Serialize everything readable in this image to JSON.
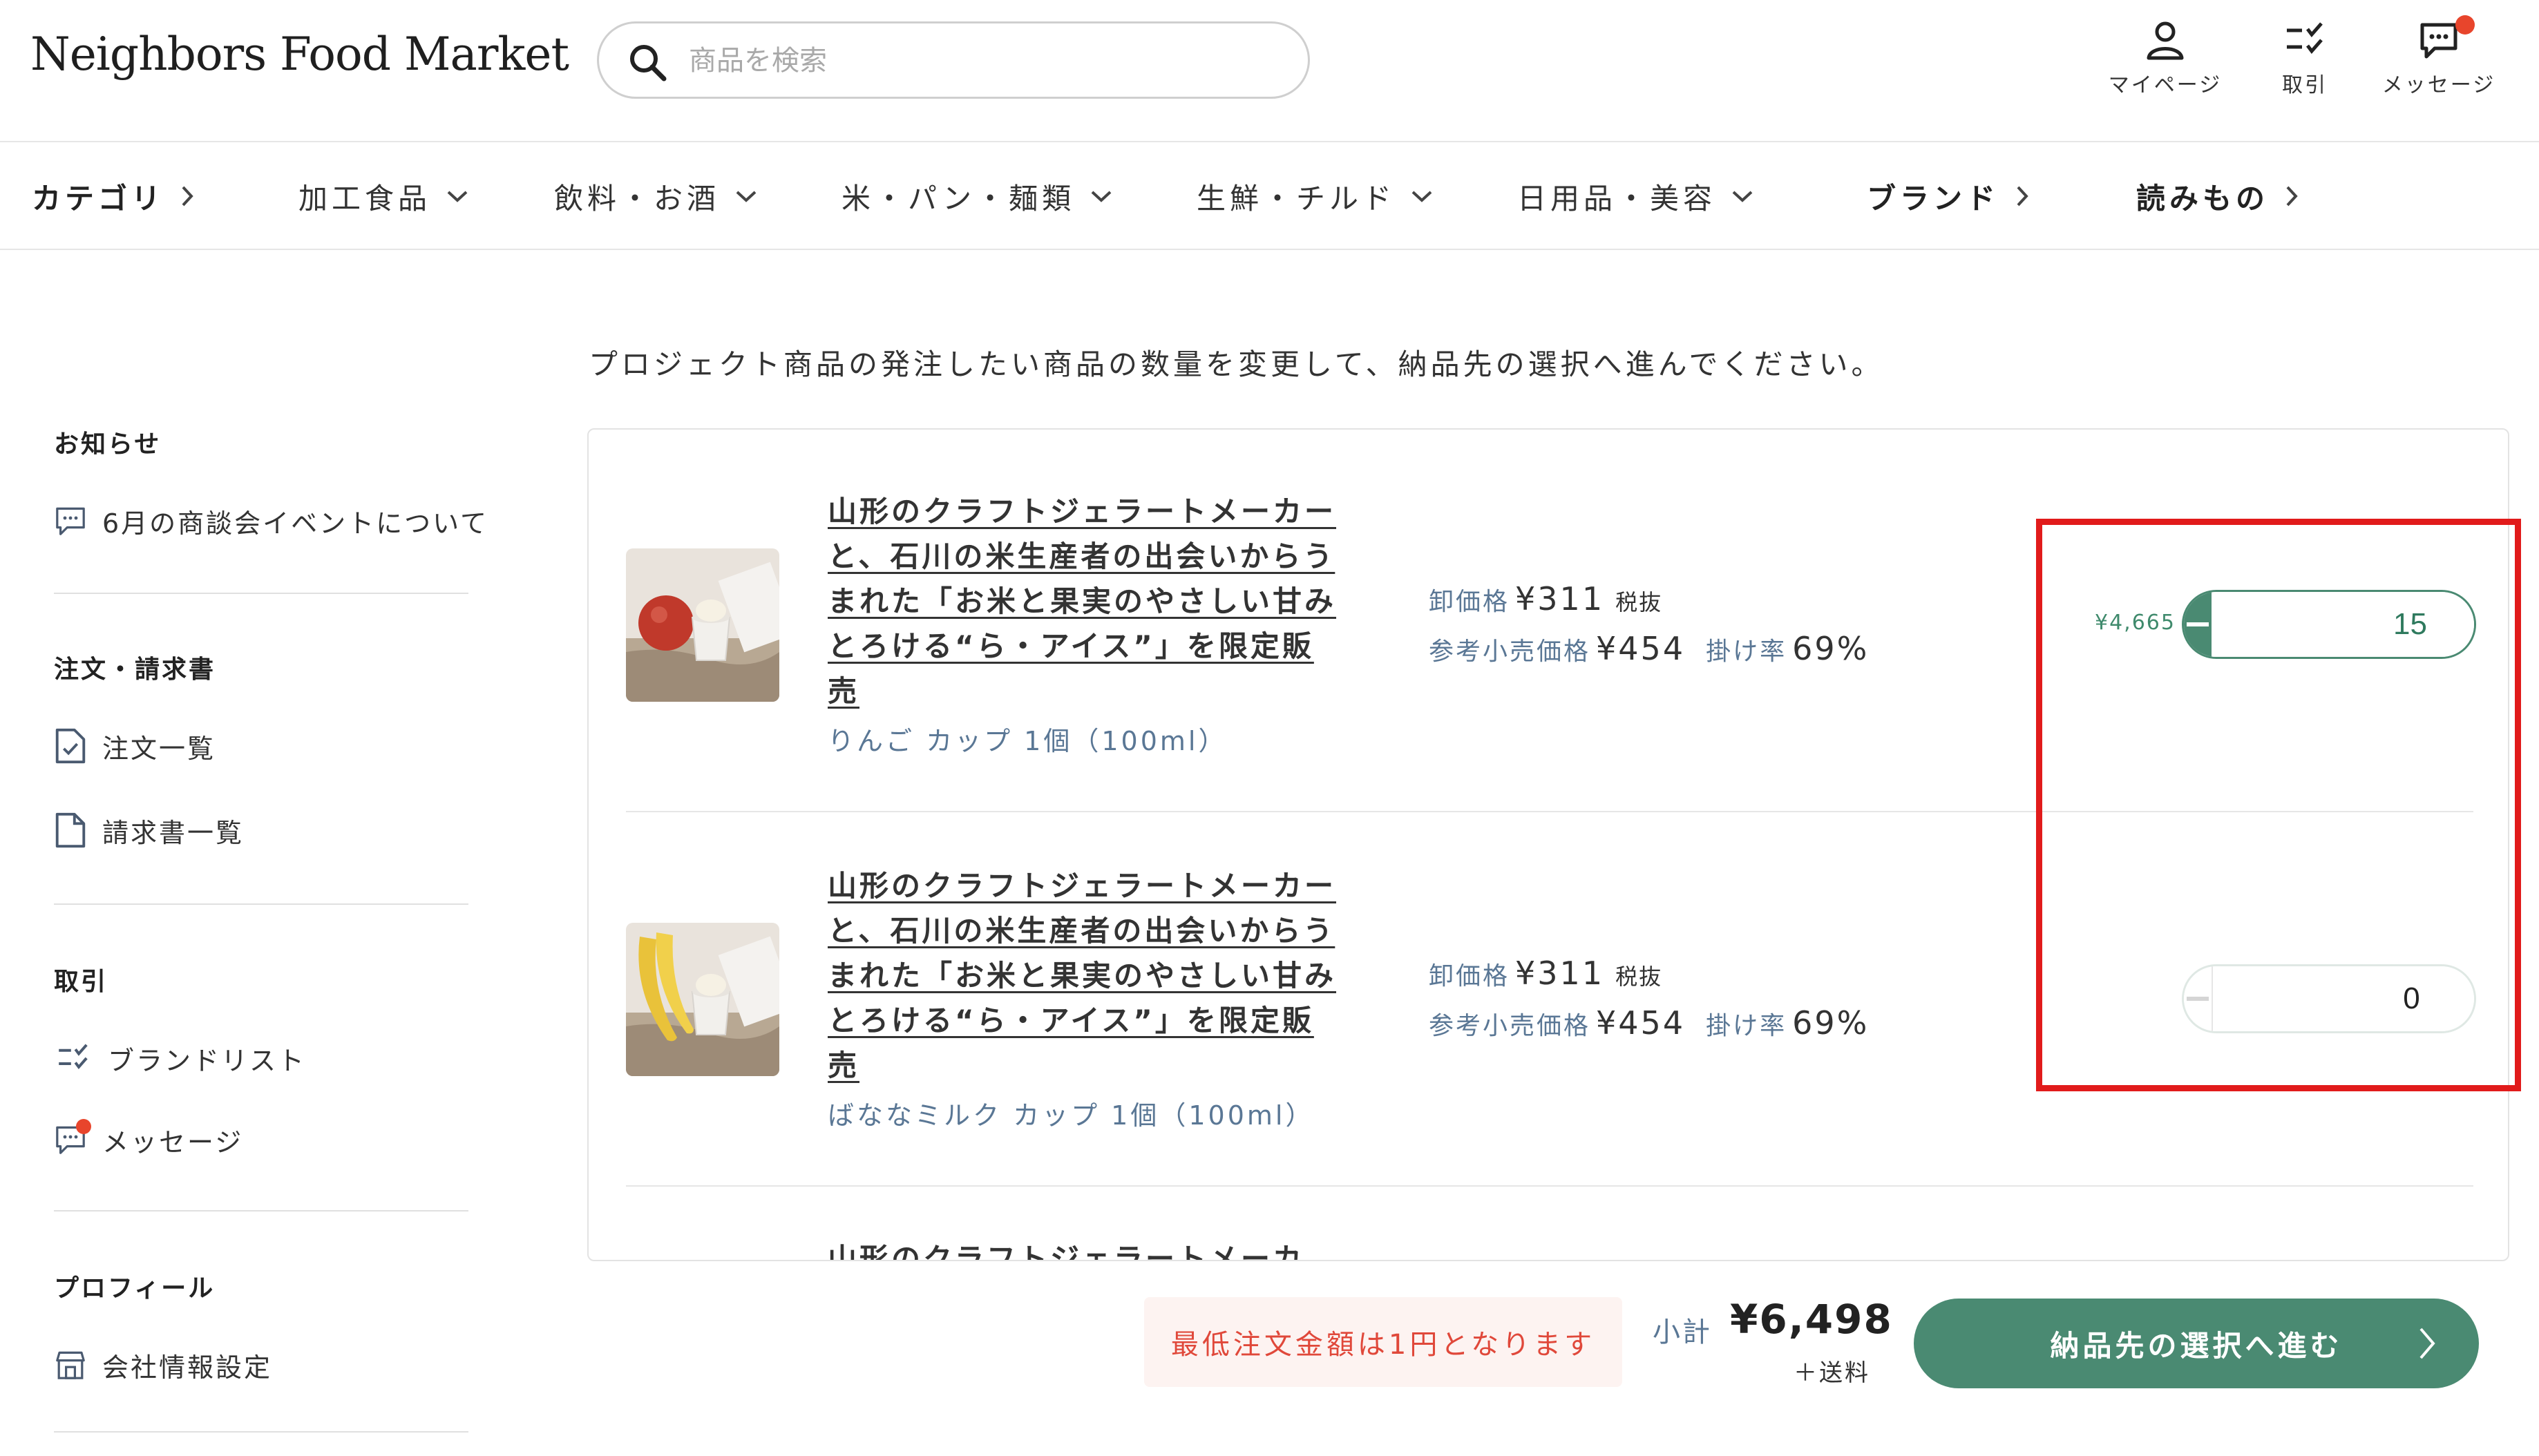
{
  "header": {
    "logo": "Neighbors Food Market",
    "search_placeholder": "商品を検索",
    "icons": [
      {
        "name": "mypage",
        "label": "マイページ",
        "icon": "person-icon"
      },
      {
        "name": "trade",
        "label": "取引",
        "icon": "checklist-icon"
      },
      {
        "name": "message",
        "label": "メッセージ",
        "icon": "message-icon",
        "has_unread": true
      }
    ]
  },
  "nav": {
    "items": [
      {
        "label": "カテゴリ",
        "chevron": "right",
        "bold": true
      },
      {
        "label": "加工食品",
        "chevron": "down"
      },
      {
        "label": "飲料・お酒",
        "chevron": "down"
      },
      {
        "label": "米・パン・麺類",
        "chevron": "down"
      },
      {
        "label": "生鮮・チルド",
        "chevron": "down"
      },
      {
        "label": "日用品・美容",
        "chevron": "down"
      },
      {
        "label": "ブランド",
        "chevron": "right",
        "bold": true
      },
      {
        "label": "読みもの",
        "chevron": "right",
        "bold": true
      }
    ]
  },
  "sidebar": {
    "sections": [
      {
        "heading": "お知らせ",
        "links": [
          {
            "label": "6月の商談会イベントについて",
            "icon": "message-icon"
          }
        ]
      },
      {
        "heading": "注文・請求書",
        "links": [
          {
            "label": "注文一覧",
            "icon": "document-check-icon"
          },
          {
            "label": "請求書一覧",
            "icon": "document-icon"
          }
        ]
      },
      {
        "heading": "取引",
        "links": [
          {
            "label": "ブランドリスト",
            "icon": "checklist-icon"
          },
          {
            "label": "メッセージ",
            "icon": "message-icon",
            "has_unread": true
          }
        ]
      },
      {
        "heading": "プロフィール",
        "links": [
          {
            "label": "会社情報設定",
            "icon": "store-icon"
          }
        ]
      }
    ]
  },
  "main": {
    "intro": "プロジェクト商品の発注したい商品の数量を変更して、納品先の選択へ進んでください。",
    "products": [
      {
        "title": "山形のクラフトジェラートメーカーと、石川の米生産者の出会いからうまれた「お米と果実のやさしい甘みとろける“ら・アイス”」を限定販売",
        "variant": "りんご カップ 1個（100ml）",
        "wholesale_label": "卸価格",
        "wholesale_price": "¥311",
        "tax_note": "税抜",
        "retail_label": "参考小売価格",
        "retail_price": "¥454",
        "rate_label": "掛け率",
        "rate": "69%",
        "line_total": "¥4,665",
        "quantity": "15",
        "image": "apple-icecream"
      },
      {
        "title": "山形のクラフトジェラートメーカーと、石川の米生産者の出会いからうまれた「お米と果実のやさしい甘みとろける“ら・アイス”」を限定販売",
        "variant": "ばななミルク カップ 1個（100ml）",
        "wholesale_label": "卸価格",
        "wholesale_price": "¥311",
        "tax_note": "税抜",
        "retail_label": "参考小売価格",
        "retail_price": "¥454",
        "rate_label": "掛け率",
        "rate": "69%",
        "line_total": "",
        "quantity": "0",
        "image": "banana-icecream"
      },
      {
        "title": "山形のクラフトジェラートメーカ"
      }
    ]
  },
  "footer": {
    "notice": "最低注文金額は1円となります",
    "subtotal_label": "小計",
    "subtotal": "¥6,498",
    "shipping_note": "＋送料",
    "cta": "納品先の選択へ進む"
  },
  "colors": {
    "accent_green": "#4a8a72",
    "annotation_red": "#e11b1b",
    "notice_red": "#e0483a",
    "muted_blue": "#5a7795",
    "unread_dot": "#e8452c"
  }
}
